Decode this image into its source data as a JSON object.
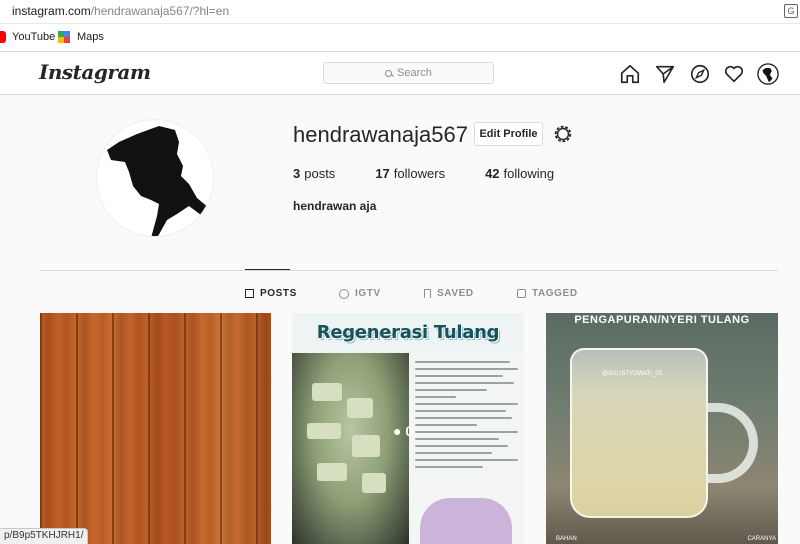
{
  "browser": {
    "url_host": "instagram.com",
    "url_path": "/hendrawanaja567/?hl=en",
    "bookmarks": [
      {
        "label": "YouTube",
        "icon": "youtube-icon"
      },
      {
        "label": "Maps",
        "icon": "maps-icon"
      }
    ],
    "status_url": "p/B9p5TKHJRH1/"
  },
  "header": {
    "logo": "Instagram",
    "search_placeholder": "Search",
    "nav_icons": [
      "home-icon",
      "direct-icon",
      "explore-icon",
      "activity-heart-icon",
      "profile-avatar-icon"
    ]
  },
  "profile": {
    "username": "hendrawanaja567",
    "edit_label": "Edit Profile",
    "stats": [
      {
        "value": "3",
        "label": "posts"
      },
      {
        "value": "17",
        "label": "followers"
      },
      {
        "value": "42",
        "label": "following"
      }
    ],
    "full_name": "hendrawan aja"
  },
  "tabs": [
    {
      "label": "POSTS",
      "icon": "grid-icon",
      "active": true
    },
    {
      "label": "IGTV",
      "icon": "igtv-icon",
      "active": false
    },
    {
      "label": "SAVED",
      "icon": "bookmark-icon",
      "active": false
    },
    {
      "label": "TAGGED",
      "icon": "tag-icon",
      "active": false
    }
  ],
  "posts": [
    {
      "kind": "wood-texture"
    },
    {
      "title": "Regenerasi Tulang Lutut",
      "overlay": "0"
    },
    {
      "banner": "PENGAPURAN/NYERI TULANG",
      "handle": "@SULISTYOWATI_05",
      "foot_left": "BAHAN",
      "foot_right": "CARANYA"
    }
  ],
  "colors": {
    "accent": "#262626",
    "border": "#dbdbdb",
    "muted": "#8e8e8e",
    "background": "#fafafa"
  }
}
